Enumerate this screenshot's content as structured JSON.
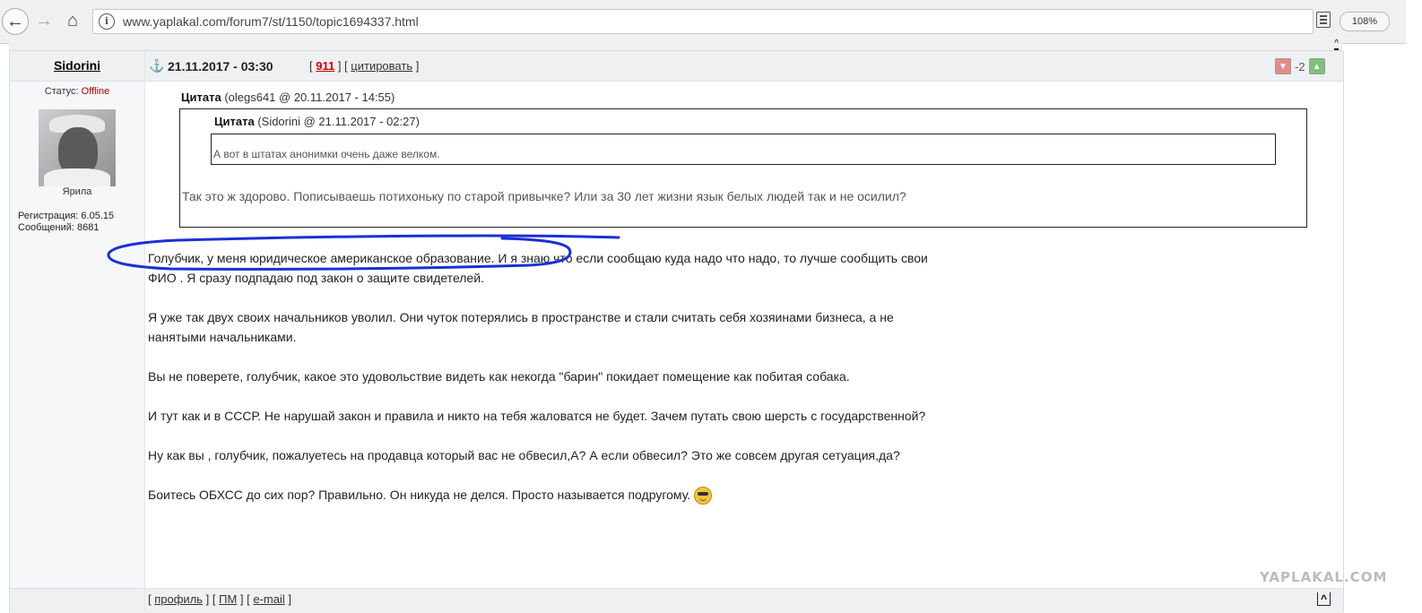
{
  "browser": {
    "url": "www.yaplakal.com/forum7/st/1150/topic1694337.html",
    "zoom": "108%",
    "info_glyph": "i"
  },
  "post": {
    "author": "Sidorini",
    "status_label": "Статус:",
    "status_value": "Offline",
    "nick": "Ярила",
    "registration": "Регистрация: 6.05.15",
    "messages": "Сообщений: 8681",
    "date": "21.11.2017 - 03:30",
    "rating_number": "911",
    "quote_action": "цитировать",
    "score": "-2",
    "quote_outer_label": "Цитата",
    "quote_outer_meta": "(olegs641 @ 20.11.2017 - 14:55)",
    "quote_inner_label": "Цитата",
    "quote_inner_meta": "(Sidorini @ 21.11.2017 - 02:27)",
    "quote_inner_text": "А вот в штатах анонимки очень даже велком.",
    "quote_outer_text": "Так это ж здорово. Пописываешь потихоньку по старой привычке? Или за 30 лет жизни язык белых людей так и не осилил?",
    "paragraphs": [
      "Голубчик, у меня юридическое американское образование. И я знаю что если сообщаю куда надо что надо, то лучше сообщить свои ФИО . Я сразу подпадаю под закон о защите свидетелей.",
      "Я уже так двух своих начальников уволил. Они чуток потерялись в пространстве и стали считать себя хозяинами бизнеса, а не нанятыми начальниками.",
      "Вы не поверете, голубчик, какое это удовольствие видеть как некогда \"барин\" покидает помещение как побитая собака.",
      "И тут как и в СССР. Не нарушай закон и правила и никто на тебя жаловатся не будет. Зачем путать свою шерсть с государственной?",
      "Ну как вы , голубчик, пожалуетесь на продавца который вас не обвесил,А? А если обвесил? Это же совсем другая сетуация,да?"
    ],
    "last_paragraph": "Боитесь ОБХСС до сих пор? Правильно. Он никуда не делся. Просто называется подругому."
  },
  "footer": {
    "profile": "профиль",
    "pm": "ПМ",
    "email": "e-mail",
    "to_top": "^"
  },
  "watermark": "YAPLAKAL.COM",
  "colors": {
    "offline": "#aa0000",
    "rating_number": "#cc0000",
    "scribble": "#1a2fd6"
  }
}
